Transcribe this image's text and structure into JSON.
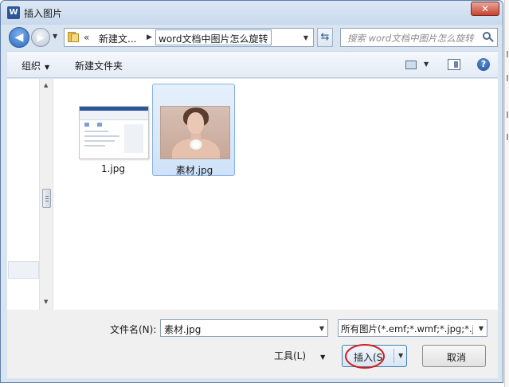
{
  "window": {
    "title": "插入图片",
    "app_icon": "W",
    "close_label": "✕"
  },
  "nav": {
    "back_glyph": "◀",
    "forward_glyph": "▶",
    "breadcrumb_overflow": "«",
    "breadcrumb": [
      "新建文...",
      "word文档中图片怎么旋转"
    ],
    "search_placeholder": "搜索 word文档中图片怎么旋转",
    "refresh_glyph": "⇆"
  },
  "toolbar": {
    "organize_label": "组织",
    "new_folder_label": "新建文件夹",
    "help_label": "?"
  },
  "files": [
    {
      "name": "1.jpg",
      "selected": false,
      "thumbnail": "document-screenshot"
    },
    {
      "name": "素材.jpg",
      "selected": true,
      "thumbnail": "portrait-photo"
    }
  ],
  "bottom": {
    "filename_label": "文件名(N):",
    "filename_value": "素材.jpg",
    "filetype_value": "所有图片(*.emf;*.wmf;*.jpg;*.jp",
    "tools_label": "工具(L)",
    "insert_label": "插入(S",
    "cancel_label": "取消"
  },
  "colors": {
    "accent": "#2b579a",
    "selection": "#cfe2f8",
    "highlight_circle": "#d41e1e"
  }
}
